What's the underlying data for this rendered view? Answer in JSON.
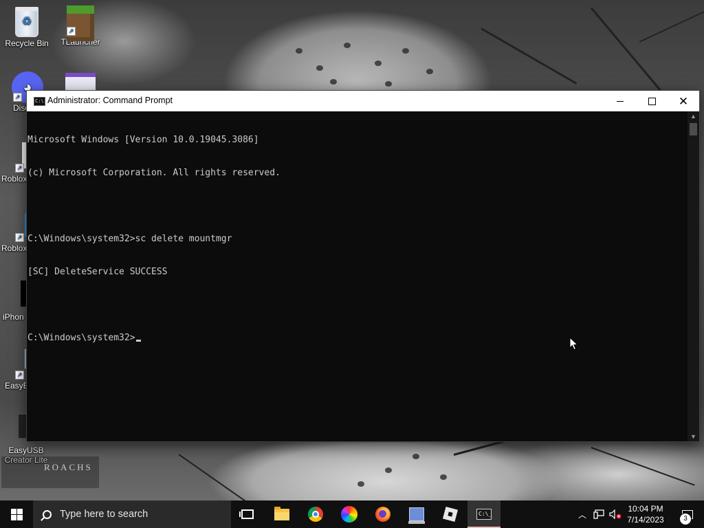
{
  "desktop": {
    "icons": [
      {
        "label": "Recycle Bin"
      },
      {
        "label": "TLauncher"
      },
      {
        "label": "Disc"
      },
      {
        "label": "Roblox"
      },
      {
        "label": "Roblox"
      },
      {
        "label": "iPhon"
      },
      {
        "label": "EasyB"
      },
      {
        "label": "EasyUSB Creator Lite"
      }
    ],
    "watermark": "ROACHS"
  },
  "window": {
    "title": "Administrator: Command Prompt",
    "icon": "cmd-icon",
    "console_lines": [
      "Microsoft Windows [Version 10.0.19045.3086]",
      "(c) Microsoft Corporation. All rights reserved.",
      "",
      "C:\\Windows\\system32>sc delete mountmgr",
      "[SC] DeleteService SUCCESS",
      "",
      "C:\\Windows\\system32>"
    ]
  },
  "taskbar": {
    "search_placeholder": "Type here to search",
    "apps": [
      {
        "name": "task-view-icon"
      },
      {
        "name": "file-explorer-icon"
      },
      {
        "name": "chrome-icon"
      },
      {
        "name": "color-wheel-icon"
      },
      {
        "name": "firefox-icon"
      },
      {
        "name": "easybcd-icon"
      },
      {
        "name": "roblox-icon"
      },
      {
        "name": "command-prompt-icon",
        "active": true
      }
    ],
    "clock_time": "10:04 PM",
    "clock_date": "7/14/2023",
    "notification_count": "3"
  },
  "colors": {
    "console_bg": "#0c0c0c",
    "console_text": "#cccccc",
    "taskbar_bg": "#101010",
    "active_indicator": "#e9b7b7"
  }
}
